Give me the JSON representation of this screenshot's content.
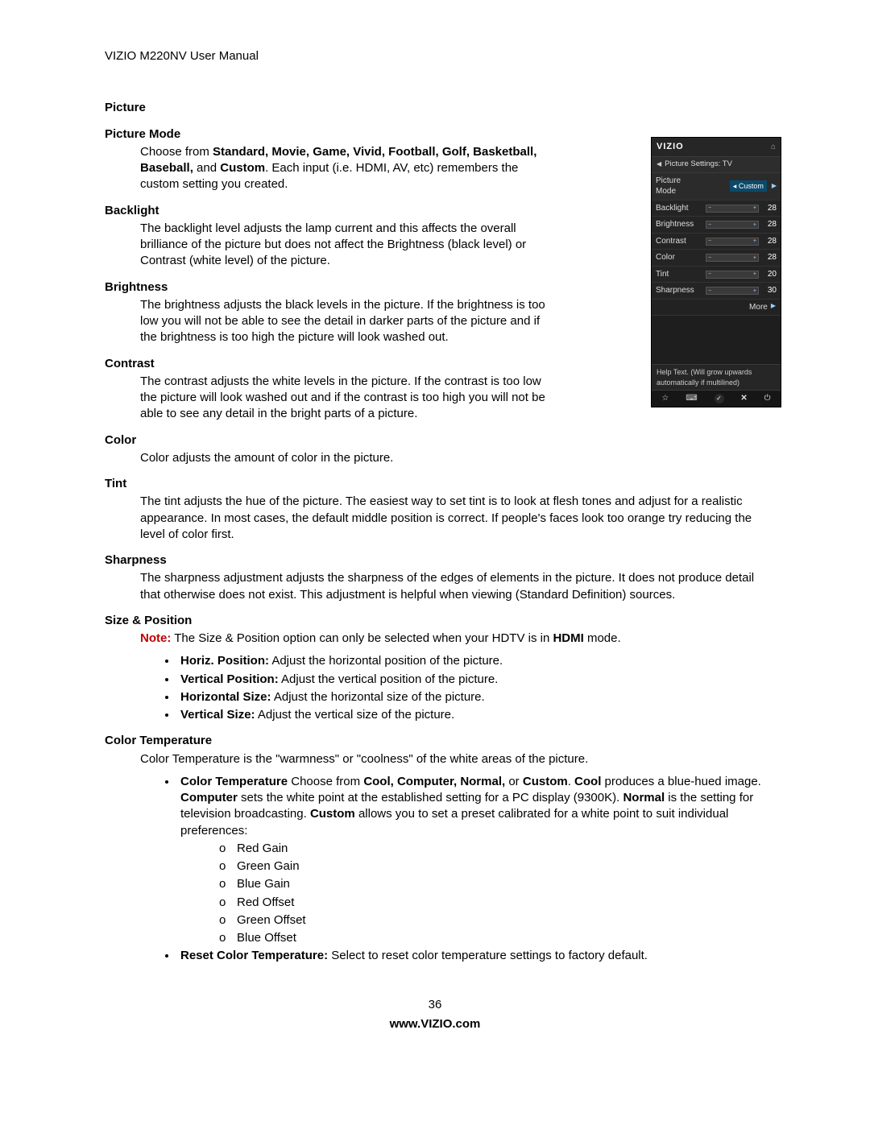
{
  "header": {
    "title": "VIZIO M220NV User Manual"
  },
  "main": {
    "section_title": "Picture",
    "picture_mode": {
      "heading": "Picture Mode",
      "text_pre": "Choose from ",
      "bold_list": "Standard, Movie, Game, Vivid, Football, Golf, Basketball, Baseball,",
      "text_mid": " and ",
      "bold_custom": "Custom",
      "text_post": ". Each input (i.e. HDMI, AV, etc) remembers the custom setting you created."
    },
    "backlight": {
      "heading": "Backlight",
      "text": "The backlight level adjusts the lamp current and this affects the overall brilliance of the picture but does not affect the Brightness (black level) or Contrast (white level) of the picture."
    },
    "brightness": {
      "heading": "Brightness",
      "text": "The brightness adjusts the black levels in the picture. If the brightness is too low you will not be able to see the detail in darker parts of the picture and if the brightness is too high the picture will look washed out."
    },
    "contrast": {
      "heading": "Contrast",
      "text": "The contrast adjusts the white levels in the picture. If the contrast is too low the picture will look washed out and if the contrast is too high you will not be able to see any detail in the bright parts of a picture."
    },
    "color": {
      "heading": "Color",
      "text": "Color adjusts the amount of color in the picture."
    },
    "tint": {
      "heading": "Tint",
      "text": "The tint adjusts the hue of the picture. The easiest way to set tint is to look at flesh tones and adjust for a realistic appearance. In most cases, the default middle position is correct. If people's faces look too orange try reducing the level of color first."
    },
    "sharpness": {
      "heading": "Sharpness",
      "text": "The sharpness adjustment adjusts the sharpness of the edges of elements in the picture. It does not produce detail that otherwise does not exist. This adjustment is helpful when viewing (Standard Definition) sources."
    },
    "size_position": {
      "heading": "Size & Position",
      "note_label": "Note:",
      "note_text_pre": " The Size & Position option can only be selected when your HDTV is in ",
      "note_bold": "HDMI",
      "note_text_post": " mode.",
      "items": [
        {
          "b": "Horiz. Position:",
          "t": " Adjust the horizontal position of the picture."
        },
        {
          "b": "Vertical Position:",
          "t": " Adjust the vertical position of the picture."
        },
        {
          "b": "Horizontal Size:",
          "t": " Adjust the horizontal size of the picture."
        },
        {
          "b": "Vertical Size:",
          "t": " Adjust the vertical size of the picture."
        }
      ]
    },
    "color_temp": {
      "heading": "Color Temperature",
      "intro": "Color Temperature is the \"warmness\" or \"coolness\" of the white areas of the picture.",
      "bullet1": {
        "b1": "Color Temperature",
        "t1": " Choose from ",
        "b2": "Cool, Computer, Normal,",
        "t2": " or ",
        "b3": "Custom",
        "t3": ". ",
        "b4": "Cool",
        "t4": " produces a blue-hued image. ",
        "b5": "Computer",
        "t5": " sets the white point at the established setting for a PC display (9300K). ",
        "b6": "Normal",
        "t6": " is the setting for television broadcasting. ",
        "b7": "Custom",
        "t7": " allows you to set a preset calibrated for a white point to suit individual preferences:"
      },
      "subs": [
        "Red Gain",
        "Green Gain",
        "Blue Gain",
        "Red Offset",
        "Green Offset",
        "Blue Offset"
      ],
      "bullet2_b": "Reset Color Temperature:",
      "bullet2_t": " Select to reset color temperature settings to factory default."
    }
  },
  "osd": {
    "logo": "VIZIO",
    "breadcrumb": "Picture Settings: TV",
    "mode_label": "Picture Mode",
    "mode_value": "Custom",
    "rows": [
      {
        "label": "Backlight",
        "value": "28"
      },
      {
        "label": "Brightness",
        "value": "28"
      },
      {
        "label": "Contrast",
        "value": "28"
      },
      {
        "label": "Color",
        "value": "28"
      },
      {
        "label": "Tint",
        "value": "20"
      },
      {
        "label": "Sharpness",
        "value": "30"
      }
    ],
    "more": "More",
    "help": "Help Text. (Will grow upwards automatically if multilined)"
  },
  "footer": {
    "page": "36",
    "url": "www.VIZIO.com"
  }
}
